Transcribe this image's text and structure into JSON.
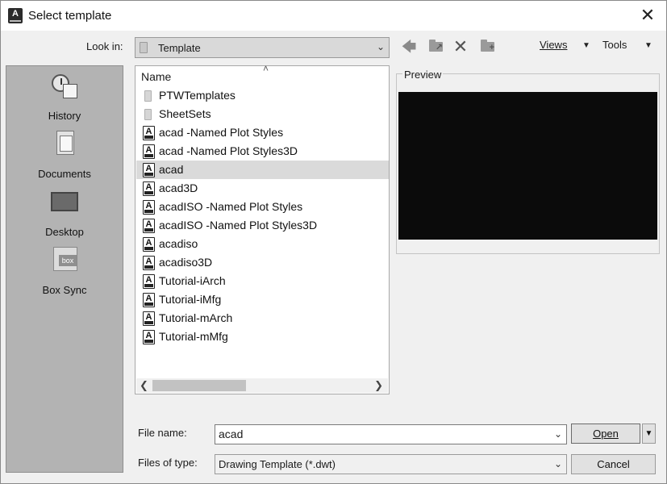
{
  "window": {
    "title": "Select template",
    "close_glyph": "✕",
    "app_icon_letter": "A"
  },
  "toolbar": {
    "look_in_label": "Look in:",
    "look_in_value": "Template",
    "back_icon": "back-arrow-icon",
    "views_label": "Views",
    "tools_label": "Tools"
  },
  "places": [
    {
      "label": "History",
      "icon": "history-icon"
    },
    {
      "label": "Documents",
      "icon": "documents-icon"
    },
    {
      "label": "Desktop",
      "icon": "desktop-icon"
    },
    {
      "label": "Box Sync",
      "icon": "box-sync-icon"
    }
  ],
  "file_list": {
    "column_header": "Name",
    "selected_index": 4,
    "items": [
      {
        "name": "PTWTemplates",
        "type": "folder"
      },
      {
        "name": "SheetSets",
        "type": "folder"
      },
      {
        "name": "acad -Named Plot Styles",
        "type": "dwt"
      },
      {
        "name": "acad -Named Plot Styles3D",
        "type": "dwt"
      },
      {
        "name": "acad",
        "type": "dwt"
      },
      {
        "name": "acad3D",
        "type": "dwt"
      },
      {
        "name": "acadISO -Named Plot Styles",
        "type": "dwt"
      },
      {
        "name": "acadISO -Named Plot Styles3D",
        "type": "dwt"
      },
      {
        "name": "acadiso",
        "type": "dwt"
      },
      {
        "name": "acadiso3D",
        "type": "dwt"
      },
      {
        "name": "Tutorial-iArch",
        "type": "dwt"
      },
      {
        "name": "Tutorial-iMfg",
        "type": "dwt"
      },
      {
        "name": "Tutorial-mArch",
        "type": "dwt"
      },
      {
        "name": "Tutorial-mMfg",
        "type": "dwt"
      }
    ]
  },
  "preview": {
    "label": "Preview"
  },
  "bottom": {
    "file_name_label": "File name:",
    "file_name_value": "acad",
    "file_type_label": "Files of type:",
    "file_type_value": "Drawing Template (*.dwt)",
    "open_label": "Open",
    "cancel_label": "Cancel"
  }
}
